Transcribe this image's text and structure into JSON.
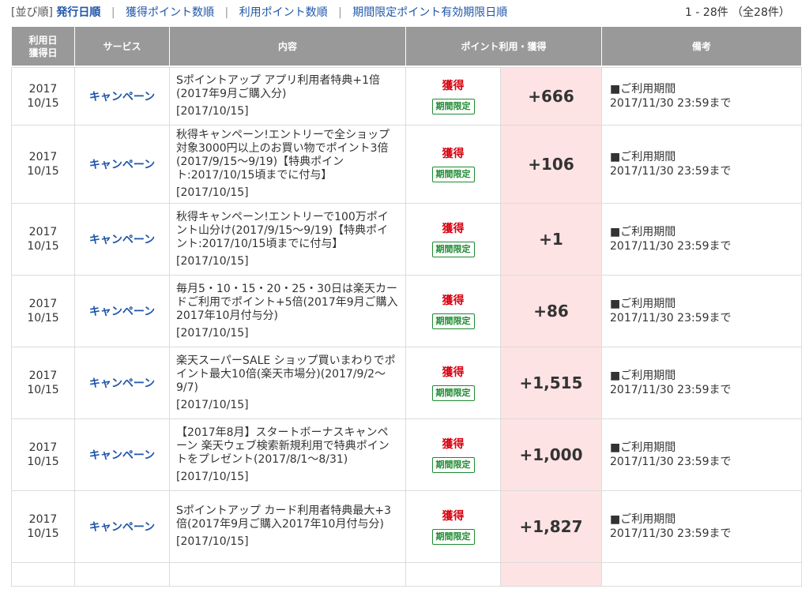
{
  "sort": {
    "label": "[並び順]",
    "options": [
      {
        "label": "発行日順",
        "active": true
      },
      {
        "label": "獲得ポイント数順",
        "active": false
      },
      {
        "label": "利用ポイント数順",
        "active": false
      },
      {
        "label": "期間限定ポイント有効期限日順",
        "active": false
      }
    ],
    "separator": "|"
  },
  "count": "1 - 28件 （全28件）",
  "headers": {
    "date": "利用日\n獲得日",
    "service": "サービス",
    "content": "内容",
    "points": "ポイント利用・獲得",
    "note": "備考"
  },
  "rows": [
    {
      "year": "2017",
      "md": "10/15",
      "service": "キャンペーン",
      "content": "Sポイントアップ アプリ利用者特典+1倍\n(2017年9月ご購入分)",
      "content_date": "[2017/10/15]",
      "type": "獲得",
      "badge": "期間限定",
      "points": "+666",
      "note1": "■ご利用期間",
      "note2": "2017/11/30 23:59まで"
    },
    {
      "year": "2017",
      "md": "10/15",
      "service": "キャンペーン",
      "content": "秋得キャンペーン!エントリーで全ショップ対象3000円以上のお買い物でポイント3倍(2017/9/15〜9/19)【特典ポイント:2017/10/15頃までに付与】",
      "content_date": "[2017/10/15]",
      "type": "獲得",
      "badge": "期間限定",
      "points": "+106",
      "note1": "■ご利用期間",
      "note2": "2017/11/30 23:59まで"
    },
    {
      "year": "2017",
      "md": "10/15",
      "service": "キャンペーン",
      "content": "秋得キャンペーン!エントリーで100万ポイント山分け(2017/9/15〜9/19)【特典ポイント:2017/10/15頃までに付与】",
      "content_date": "[2017/10/15]",
      "type": "獲得",
      "badge": "期間限定",
      "points": "+1",
      "note1": "■ご利用期間",
      "note2": "2017/11/30 23:59まで"
    },
    {
      "year": "2017",
      "md": "10/15",
      "service": "キャンペーン",
      "content": "毎月5・10・15・20・25・30日は楽天カードご利用でポイント+5倍(2017年9月ご購入2017年10月付与分)",
      "content_date": "[2017/10/15]",
      "type": "獲得",
      "badge": "期間限定",
      "points": "+86",
      "note1": "■ご利用期間",
      "note2": "2017/11/30 23:59まで"
    },
    {
      "year": "2017",
      "md": "10/15",
      "service": "キャンペーン",
      "content": "楽天スーパーSALE ショップ買いまわりでポイント最大10倍(楽天市場分)(2017/9/2〜9/7)",
      "content_date": "[2017/10/15]",
      "type": "獲得",
      "badge": "期間限定",
      "points": "+1,515",
      "note1": "■ご利用期間",
      "note2": "2017/11/30 23:59まで"
    },
    {
      "year": "2017",
      "md": "10/15",
      "service": "キャンペーン",
      "content": "【2017年8月】スタートボーナスキャンペーン 楽天ウェブ検索新規利用で特典ポイントをプレゼント(2017/8/1〜8/31)",
      "content_date": "[2017/10/15]",
      "type": "獲得",
      "badge": "期間限定",
      "points": "+1,000",
      "note1": "■ご利用期間",
      "note2": "2017/11/30 23:59まで"
    },
    {
      "year": "2017",
      "md": "10/15",
      "service": "キャンペーン",
      "content": "Sポイントアップ カード利用者特典最大+3倍(2017年9月ご購入2017年10月付与分)",
      "content_date": "[2017/10/15]",
      "type": "獲得",
      "badge": "期間限定",
      "points": "+1,827",
      "note1": "■ご利用期間",
      "note2": "2017/11/30 23:59まで"
    }
  ]
}
